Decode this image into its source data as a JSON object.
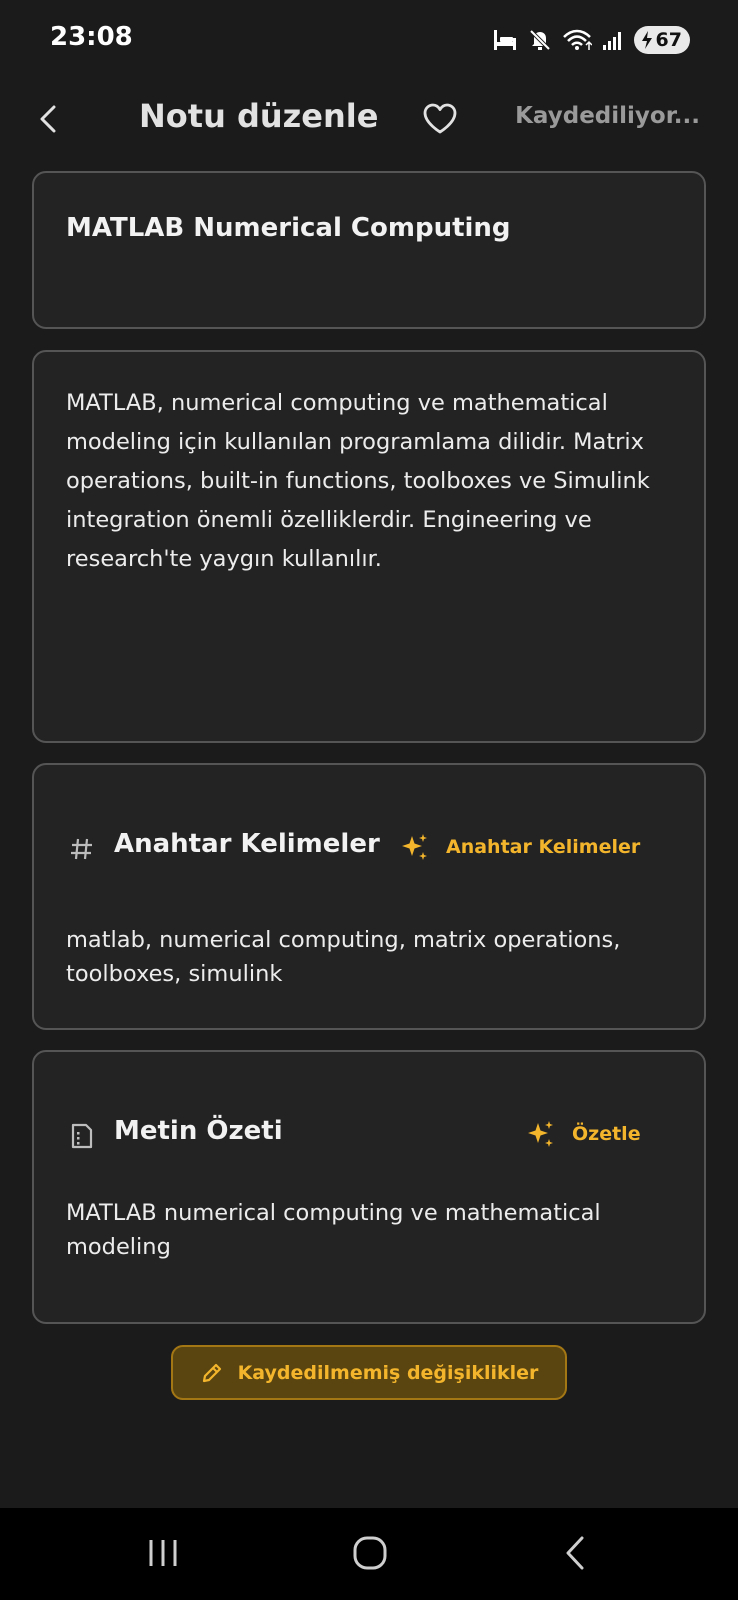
{
  "status_bar": {
    "time": "23:08",
    "battery": "67",
    "icons": [
      "sleep-mode-icon",
      "mute-icon",
      "wifi-icon",
      "signal-icon",
      "charging-icon"
    ]
  },
  "header": {
    "title": "Notu düzenle",
    "saving_status": "Kaydediliyor...",
    "icons": [
      "back-arrow-icon",
      "heart-icon"
    ]
  },
  "note": {
    "title": "MATLAB Numerical Computing",
    "body": "MATLAB, numerical computing ve mathematical modeling için kullanılan programlama dilidir. Matrix operations, built-in functions, toolboxes ve Simulink integration önemli özelliklerdir. Engineering ve research'te yaygın kullanılır."
  },
  "keywords": {
    "title": "Anahtar Kelimeler",
    "action_label": "Anahtar Kelimeler",
    "text": "matlab, numerical computing, matrix operations, toolboxes, simulink",
    "icons": [
      "hashtag-icon",
      "sparkles-icon"
    ]
  },
  "summary": {
    "title": "Metin Özeti",
    "action_label": "Özetle",
    "text": "MATLAB numerical computing ve mathematical modeling",
    "icons": [
      "document-icon",
      "sparkles-icon"
    ]
  },
  "unsaved": {
    "label": "Kaydedilmemiş değişiklikler",
    "icon": "pencil-icon"
  },
  "nav_bar": {
    "icons": [
      "recent-apps-icon",
      "home-icon",
      "back-icon"
    ]
  },
  "colors": {
    "background": "#1b1b1b",
    "card": "#232323",
    "card_border": "#555555",
    "accent": "#f3b52c",
    "pill_bg": "#5a4510"
  }
}
